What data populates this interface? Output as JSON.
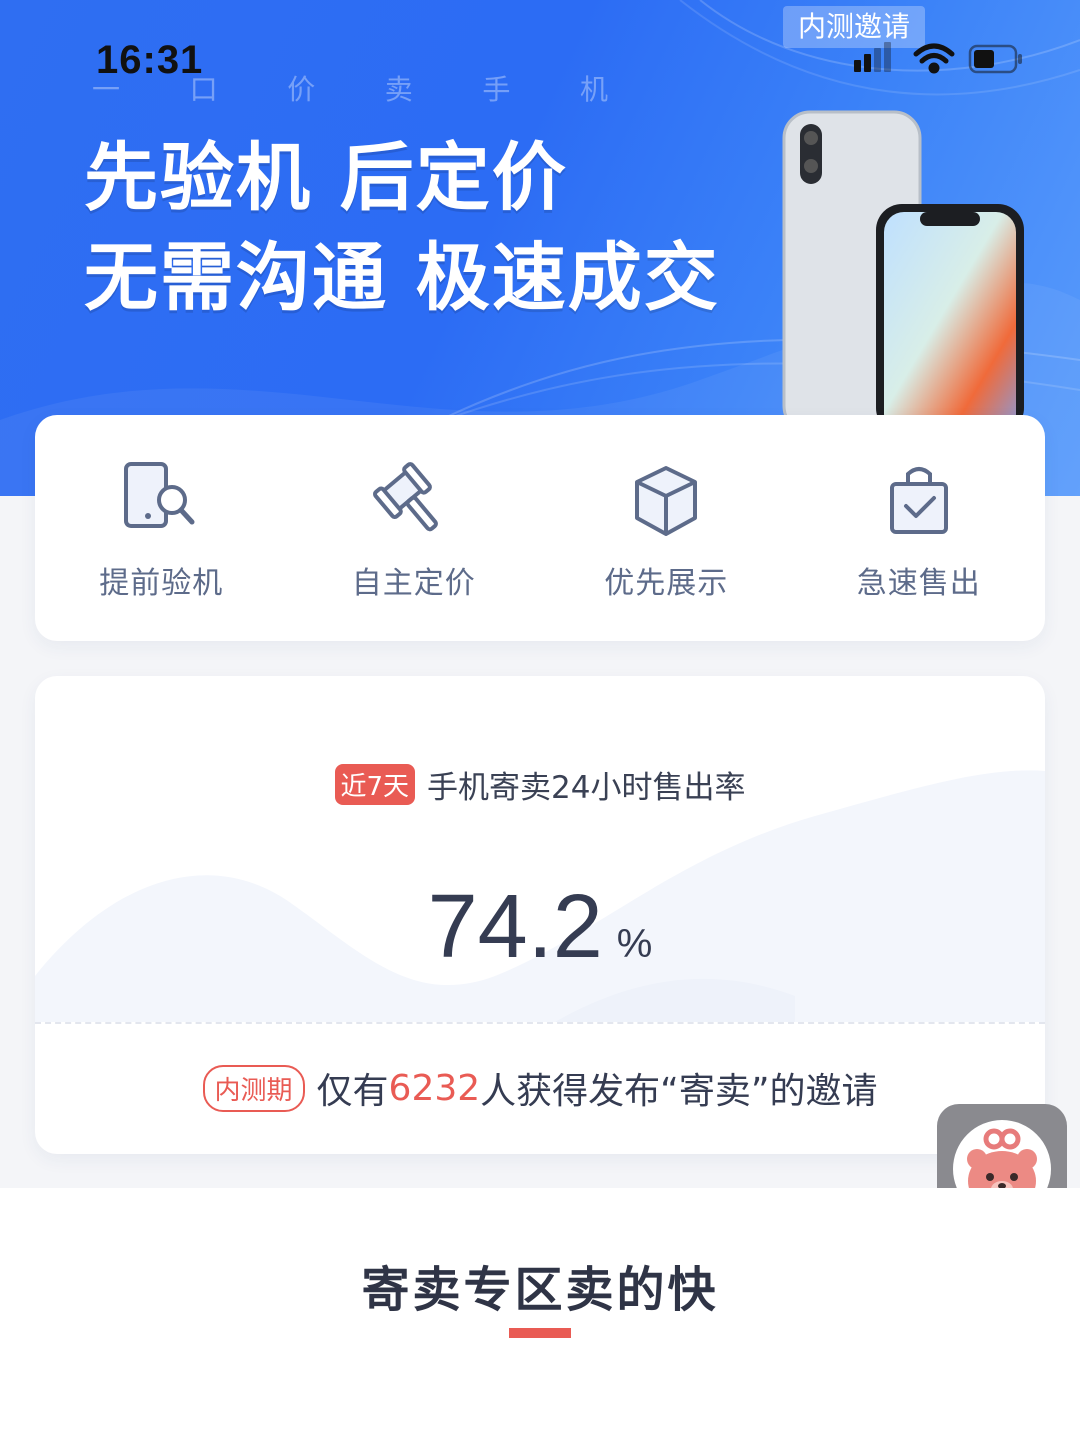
{
  "status_bar": {
    "time": "16:31"
  },
  "banner": {
    "invite_tag": "内测邀请",
    "sub_chars": [
      "一",
      "口",
      "价",
      "卖",
      "手",
      "机"
    ],
    "line1": "先验机 后定价",
    "line2": "无需沟通 极速成交"
  },
  "features": [
    {
      "icon": "phone-search-icon",
      "label": "提前验机"
    },
    {
      "icon": "gavel-icon",
      "label": "自主定价"
    },
    {
      "icon": "box-icon",
      "label": "优先展示"
    },
    {
      "icon": "shopping-bag-check-icon",
      "label": "急速售出"
    }
  ],
  "stats": {
    "badge": "近7天",
    "title": "手机寄卖24小时售出率",
    "value": "74.2",
    "unit": "%",
    "invite_badge": "内测期",
    "invite_prefix": "仅有",
    "invite_count": "6232",
    "invite_suffix": "人获得发布“寄卖”的邀请"
  },
  "float_button": {
    "icon": "bear-mascot-icon"
  },
  "section": {
    "title": "寄卖专区卖的快"
  },
  "colors": {
    "accent": "#e95b54",
    "banner_blue": "#2f6ef2"
  }
}
